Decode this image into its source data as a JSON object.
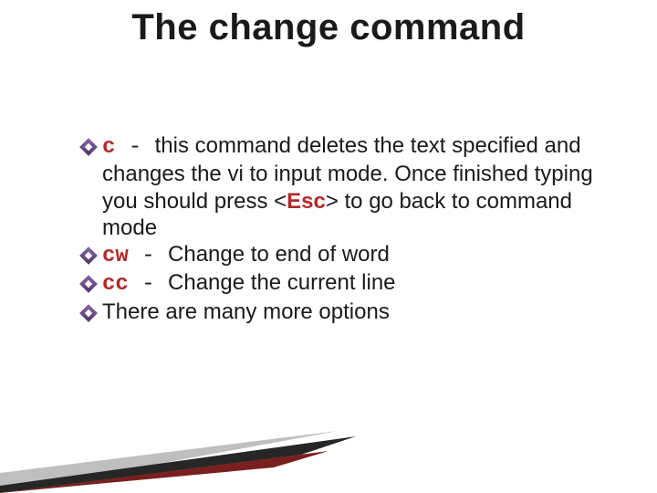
{
  "title": "The change command",
  "bullets": [
    {
      "cmd": "c",
      "sep": " - ",
      "text_before_esc": "this command deletes the text specified and changes the vi to input mode. Once finished typing you should press ",
      "esc_open": "<",
      "esc_word": "Esc",
      "esc_close": ">",
      "text_after_esc": " to go back to command mode"
    },
    {
      "cmd": "cw",
      "sep": " - ",
      "text": "Change to end of word"
    },
    {
      "cmd": "cc",
      "sep": " - ",
      "text": "Change the current line"
    },
    {
      "text": "There are many more options"
    }
  ]
}
